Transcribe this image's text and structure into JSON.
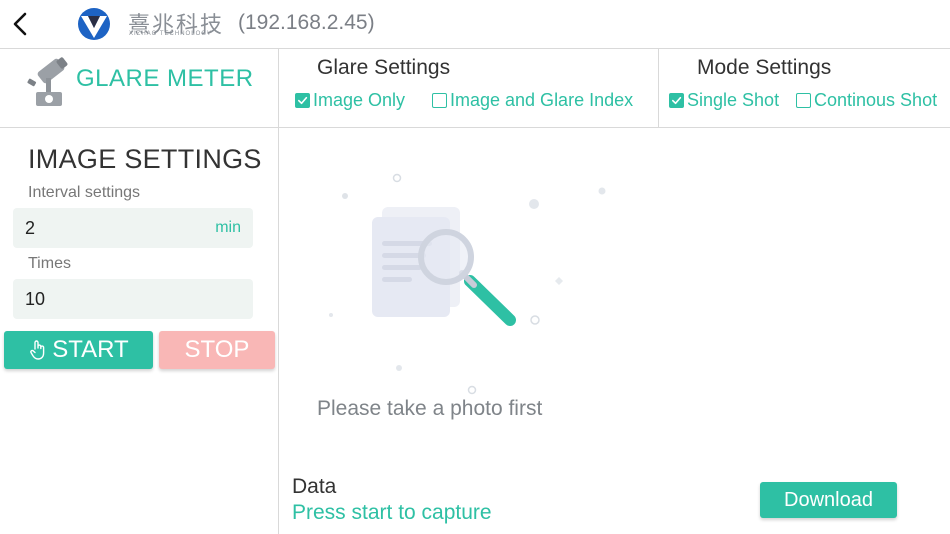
{
  "header": {
    "logo_cn": "熹兆科技",
    "logo_en": "XIZHAO TECHNOLOGY",
    "ip": "(192.168.2.45)"
  },
  "sidebar": {
    "title": "GLARE METER",
    "section_title": "IMAGE SETTINGS",
    "interval": {
      "label": "Interval settings",
      "value": "2",
      "unit": "min"
    },
    "times": {
      "label": "Times",
      "value": "10"
    },
    "start_label": "START",
    "stop_label": "STOP"
  },
  "glare_settings": {
    "title": "Glare Settings",
    "options": [
      {
        "label": "Image Only",
        "checked": true
      },
      {
        "label": "Image and Glare Index",
        "checked": false
      }
    ]
  },
  "mode_settings": {
    "title": "Mode Settings",
    "options": [
      {
        "label": "Single Shot",
        "checked": true
      },
      {
        "label": "Continous Shot",
        "checked": false
      }
    ]
  },
  "main": {
    "empty_text": "Please take a photo first",
    "data_label": "Data",
    "data_status": "Press start to capture",
    "download_label": "Download"
  },
  "colors": {
    "accent": "#2ec0a4",
    "stop": "#f9b7b6",
    "divider": "#d9d9d9"
  },
  "icons": [
    "back-chevron-icon",
    "company-logo-icon",
    "camera-icon",
    "checkbox-checked-icon",
    "checkbox-unchecked-icon",
    "hand-pointer-icon",
    "document-search-icon"
  ]
}
